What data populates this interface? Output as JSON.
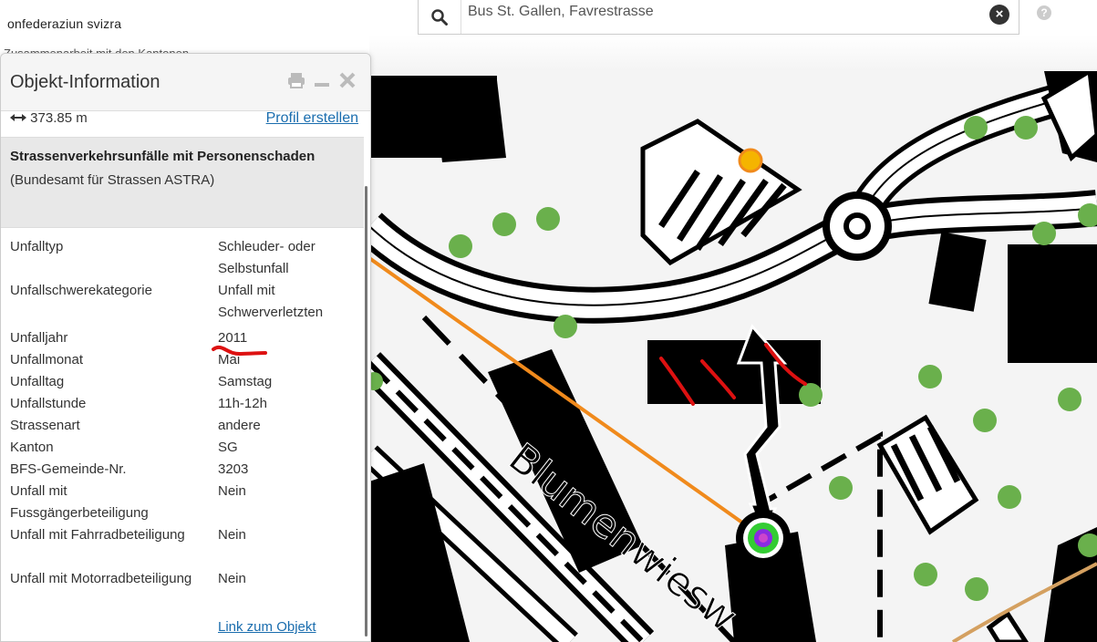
{
  "header": {
    "brand_text": "onfederaziun svizra",
    "brand_sub": "Zusammenarbeit mit den Kantonen"
  },
  "search": {
    "value": "Bus St. Gallen, Favrestrasse",
    "icon": "search-icon",
    "clear_icon": "close-icon",
    "help_icon": "help-icon",
    "help_glyph": "?"
  },
  "panel": {
    "title": "Objekt-Information",
    "icons": [
      "print-icon",
      "minimize-icon",
      "close-icon"
    ],
    "measure_value": "373.85 m",
    "profile_link": "Profil erstellen",
    "layer_title_bold": "Strassenverkehrsunfälle mit Personenschaden",
    "layer_source": " (Bundesamt für Strassen ASTRA)",
    "attributes": [
      {
        "key": "Unfalltyp",
        "value": "Schleuder- oder Selbstunfall"
      },
      {
        "key": "Unfallschwerekategorie",
        "value": "Unfall mit Schwerverletzten"
      },
      {
        "key": "Unfalljahr",
        "value": "2011"
      },
      {
        "key": "Unfallmonat",
        "value": "Mai"
      },
      {
        "key": "Unfalltag",
        "value": "Samstag"
      },
      {
        "key": "Unfallstunde",
        "value": "11h-12h"
      },
      {
        "key": "Strassenart",
        "value": "andere"
      },
      {
        "key": "Kanton",
        "value": "SG"
      },
      {
        "key": "BFS-Gemeinde-Nr.",
        "value": "3203"
      },
      {
        "key": "Unfall mit Fussgängerbeteiligung",
        "value": "Nein"
      },
      {
        "key": "Unfall mit Fahrradbeteiligung",
        "value": "Nein"
      },
      {
        "key": "Unfall mit Motorradbeteiligung",
        "value": "Nein"
      }
    ],
    "object_link": "Link zum Objekt"
  },
  "map": {
    "street_label": "Blumenwiesw",
    "colors": {
      "background": "#f4f4f4",
      "building": "#000000",
      "tree": "#6ab04c",
      "measure_line": "#f08a1c",
      "accident_marker_outer": "#33cc33",
      "accident_marker_inner": "#8a2be2",
      "bus_stop_marker": "#f5b400",
      "annotation_red": "#dd1111"
    }
  }
}
